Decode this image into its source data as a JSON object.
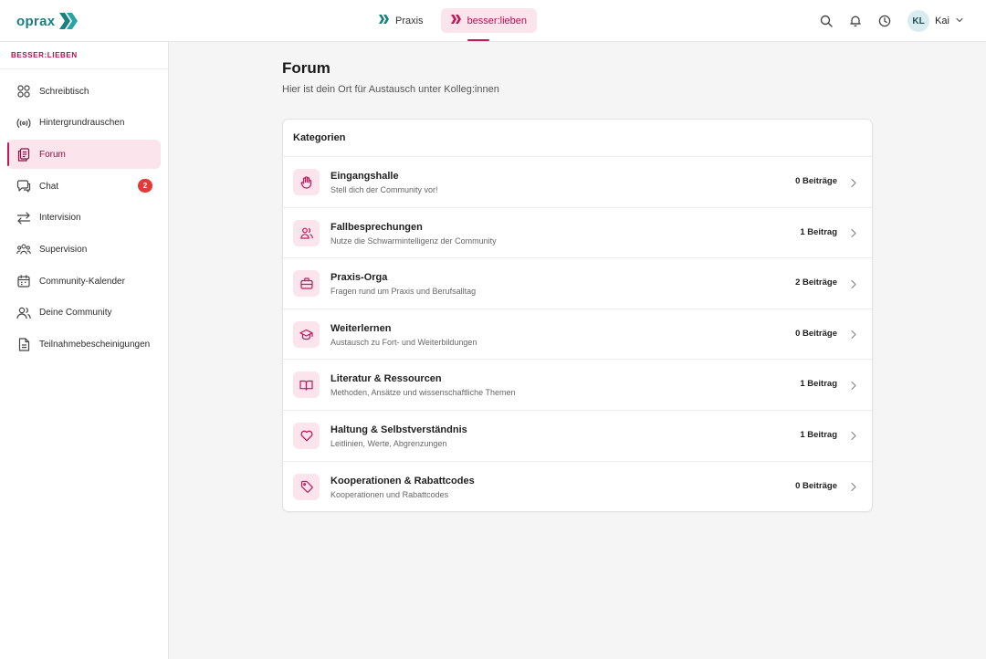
{
  "app": {
    "logo_text": "oprax"
  },
  "topnav": {
    "items": [
      {
        "label": "Praxis"
      },
      {
        "label": "besser:lieben"
      }
    ]
  },
  "user": {
    "initials": "KL",
    "name": "Kai"
  },
  "sidebar": {
    "section_title": "BESSER:LIEBEN",
    "items": [
      {
        "label": "Schreibtisch",
        "icon": "grid-icon"
      },
      {
        "label": "Hintergrundrauschen",
        "icon": "broadcast-icon"
      },
      {
        "label": "Forum",
        "icon": "forum-icon"
      },
      {
        "label": "Chat",
        "icon": "chat-icon",
        "badge": "2"
      },
      {
        "label": "Intervision",
        "icon": "arrows-swap-icon"
      },
      {
        "label": "Supervision",
        "icon": "group-icon"
      },
      {
        "label": "Community-Kalender",
        "icon": "calendar-icon"
      },
      {
        "label": "Deine Community",
        "icon": "users-icon"
      },
      {
        "label": "Teilnahmebescheinigungen",
        "icon": "document-icon"
      }
    ]
  },
  "main": {
    "title": "Forum",
    "subtitle": "Hier ist dein Ort für Austausch unter Kolleg:innen",
    "card_title": "Kategorien",
    "categories": [
      {
        "title": "Eingangshalle",
        "desc": "Stell dich der Community vor!",
        "count": "0 Beiträge",
        "icon": "hand-icon"
      },
      {
        "title": "Fallbesprechungen",
        "desc": "Nutze die Schwarmintelligenz der Community",
        "count": "1 Beitrag",
        "icon": "people-icon"
      },
      {
        "title": "Praxis-Orga",
        "desc": "Fragen rund um Praxis und Berufsalltag",
        "count": "2 Beiträge",
        "icon": "briefcase-icon"
      },
      {
        "title": "Weiterlernen",
        "desc": "Austausch zu Fort- und Weiterbildungen",
        "count": "0 Beiträge",
        "icon": "graduation-cap-icon"
      },
      {
        "title": "Literatur & Ressourcen",
        "desc": "Methoden, Ansätze und wissenschaftliche Themen",
        "count": "1 Beitrag",
        "icon": "book-icon"
      },
      {
        "title": "Haltung & Selbstverständnis",
        "desc": "Leitlinien, Werte, Abgrenzungen",
        "count": "1 Beitrag",
        "icon": "heart-icon"
      },
      {
        "title": "Kooperationen & Rabattcodes",
        "desc": "Kooperationen und Rabattcodes",
        "count": "0 Beiträge",
        "icon": "tag-icon"
      }
    ]
  },
  "colors": {
    "brand_teal": "#1a7f80",
    "accent_pink": "#c2185b",
    "accent_pink_bg": "#fbe4ec",
    "badge_red": "#e53935"
  }
}
